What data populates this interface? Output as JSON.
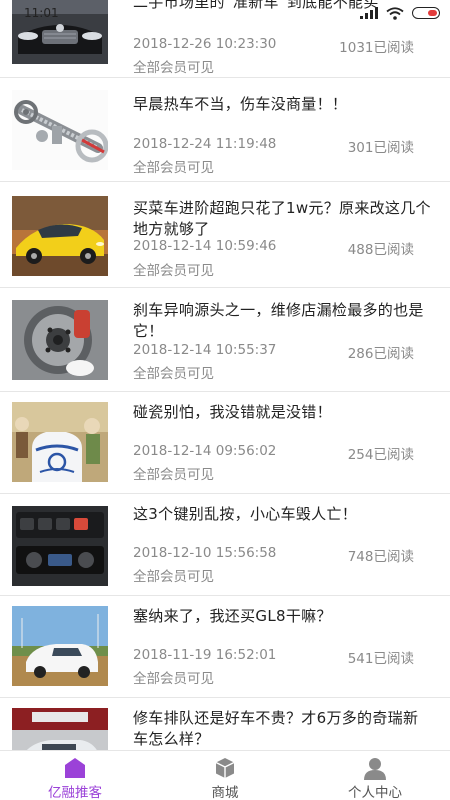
{
  "status_bar": {
    "time": "11:01"
  },
  "articles": [
    {
      "title": "二手市场里的“准新车”到底能不能买",
      "date": "2018-12-26 10:23:30",
      "reads": "1031已阅读",
      "visibility": "全部会员可见",
      "thumb": "car-front-dark"
    },
    {
      "title": "早晨热车不当，伤车没商量！！",
      "date": "2018-12-24 11:19:48",
      "reads": "301已阅读",
      "visibility": "全部会员可见",
      "thumb": "engine-timing-chain"
    },
    {
      "title": "买菜车进阶超跑只花了1w元？原来改这几个地方就够了",
      "date": "2018-12-14 10:59:46",
      "reads": "488已阅读",
      "visibility": "全部会员可见",
      "thumb": "yellow-sports-car"
    },
    {
      "title": "刹车异响源头之一，维修店漏检最多的也是它！",
      "date": "2018-12-14 10:55:37",
      "reads": "286已阅读",
      "visibility": "全部会员可见",
      "thumb": "brake-disc"
    },
    {
      "title": "碰瓷别怕，我没错就是没错！",
      "date": "2018-12-14 09:56:02",
      "reads": "254已阅读",
      "visibility": "全部会员可见",
      "thumb": "porcelain-vase-cartoon"
    },
    {
      "title": "这3个键别乱按，小心车毁人亡！",
      "date": "2018-12-10 15:56:58",
      "reads": "748已阅读",
      "visibility": "全部会员可见",
      "thumb": "car-dashboard-buttons"
    },
    {
      "title": "塞纳来了，我还买GL8干嘛？",
      "date": "2018-11-19 16:52:01",
      "reads": "541已阅读",
      "visibility": "全部会员可见",
      "thumb": "white-minivan"
    },
    {
      "title": "修车排队还是好车不贵？才6万多的奇瑞新车怎么样？",
      "date": "",
      "reads": "",
      "visibility": "",
      "thumb": "chery-car"
    }
  ],
  "tabs": [
    {
      "label": "亿融推客",
      "icon": "home-icon",
      "active": true
    },
    {
      "label": "商城",
      "icon": "box-icon",
      "active": false
    },
    {
      "label": "个人中心",
      "icon": "person-icon",
      "active": false
    }
  ],
  "colors": {
    "accent": "#9b42d8",
    "meta_text": "#8a8a8a",
    "divider": "#e6e6e6"
  }
}
